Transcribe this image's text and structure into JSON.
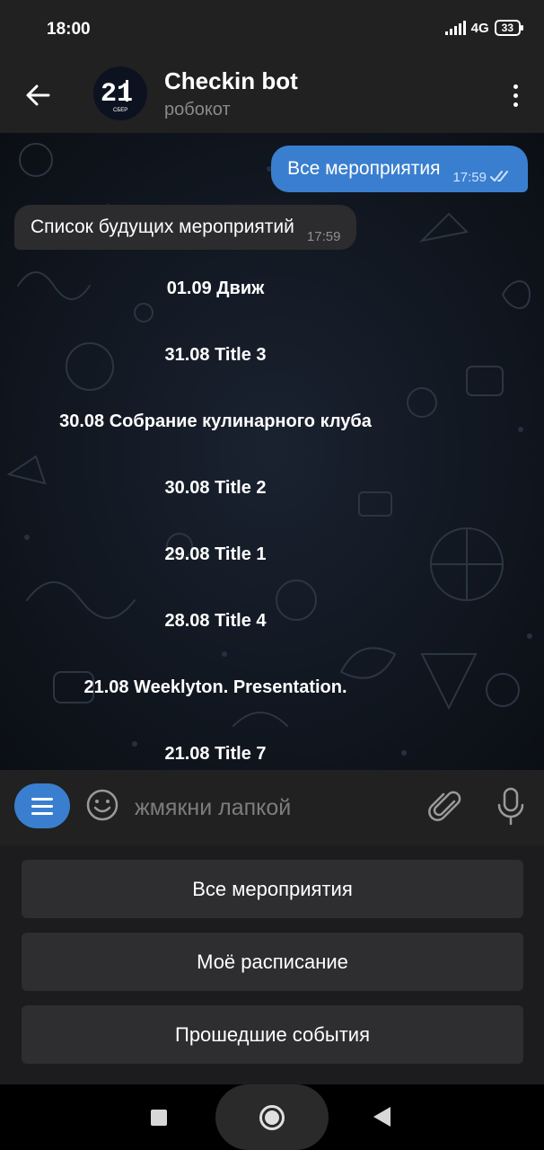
{
  "status_bar": {
    "time": "18:00",
    "network": "4G",
    "battery": "33"
  },
  "header": {
    "title": "Checkin bot",
    "subtitle": "робокот",
    "avatar_text": "21",
    "avatar_caption": "СБЕР"
  },
  "messages": {
    "outgoing": {
      "text": "Все мероприятия",
      "time": "17:59"
    },
    "incoming": {
      "text": "Список будущих мероприятий",
      "time": "17:59"
    }
  },
  "inline_buttons": [
    "01.09 Движ",
    "31.08 Title 3",
    "30.08 Собрание кулинарного клуба",
    "30.08 Title 2",
    "29.08 Title 1",
    "28.08 Title 4",
    "21.08 Weeklyton. Presentation.",
    "21.08 Title 7"
  ],
  "input": {
    "placeholder": "жмякни лапкой"
  },
  "keyboard": {
    "all_events": "Все мероприятия",
    "my_schedule": "Моё расписание",
    "past_events": "Прошедшие события"
  },
  "colors": {
    "accent": "#3a7fcf",
    "header_bg": "#212121",
    "chat_bg": "#0f141b",
    "incoming_bubble": "#2c2c2e"
  },
  "icons": [
    "back-arrow-icon",
    "more-vert-icon",
    "double-check-icon",
    "menu-icon",
    "emoji-icon",
    "paperclip-icon",
    "microphone-icon",
    "signal-icon",
    "battery-icon"
  ]
}
